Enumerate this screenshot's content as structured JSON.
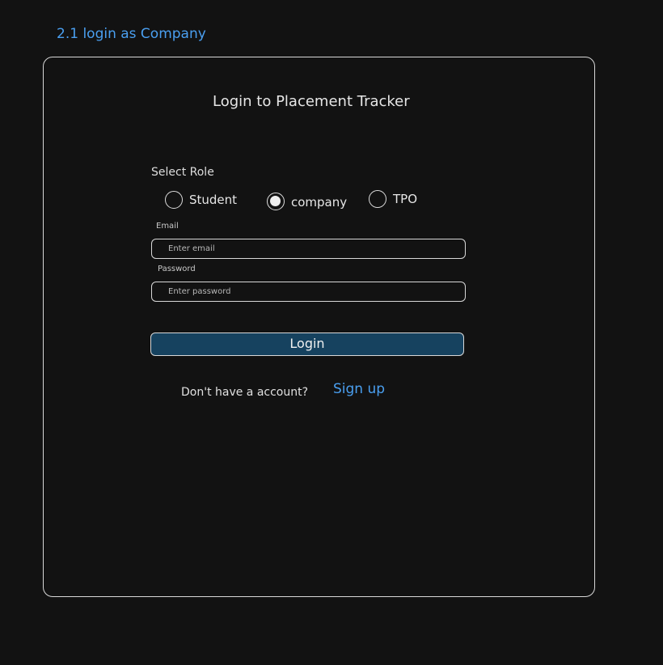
{
  "section_heading": "2.1 login as Company",
  "form": {
    "title": "Login to Placement Tracker",
    "role_label": "Select Role",
    "roles": [
      {
        "label": "Student",
        "selected": false
      },
      {
        "label": "company",
        "selected": true
      },
      {
        "label": "TPO",
        "selected": false
      }
    ],
    "email_label": "Email",
    "email_placeholder": "Enter email",
    "email_value": "",
    "password_label": "Password",
    "password_placeholder": "Enter password",
    "password_value": "",
    "login_label": "Login",
    "signup_prompt": "Don't have a account?",
    "signup_link": "Sign up"
  },
  "colors": {
    "background": "#121212",
    "accent": "#4a9ff0",
    "button": "#16425f",
    "border": "#d8d8d8"
  }
}
